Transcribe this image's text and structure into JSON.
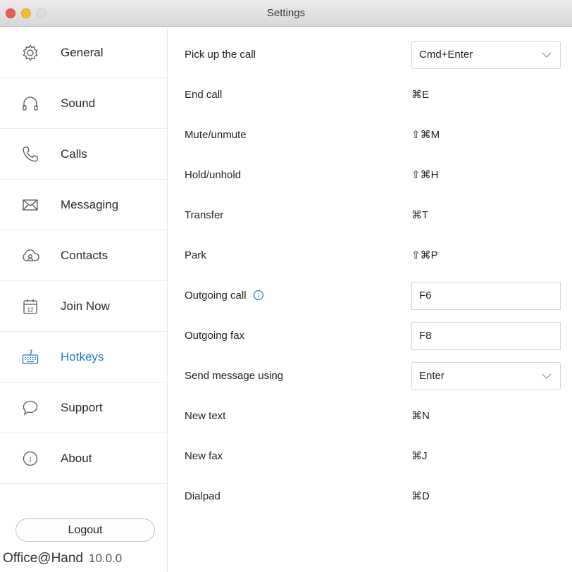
{
  "window": {
    "title": "Settings"
  },
  "sidebar": {
    "items": [
      {
        "label": "General",
        "icon": "gear-icon"
      },
      {
        "label": "Sound",
        "icon": "headphones-icon"
      },
      {
        "label": "Calls",
        "icon": "phone-icon"
      },
      {
        "label": "Messaging",
        "icon": "envelope-icon"
      },
      {
        "label": "Contacts",
        "icon": "cloud-contacts-icon"
      },
      {
        "label": "Join Now",
        "icon": "calendar-icon"
      },
      {
        "label": "Hotkeys",
        "icon": "keyboard-icon",
        "active": true
      },
      {
        "label": "Support",
        "icon": "chat-bubble-icon"
      },
      {
        "label": "About",
        "icon": "info-icon"
      }
    ],
    "logout_label": "Logout"
  },
  "footer": {
    "brand": "Office@Hand",
    "version": "10.0.0"
  },
  "accent_color": "#1f7ac8",
  "hotkeys": [
    {
      "label": "Pick up the call",
      "type": "select",
      "value": "Cmd+Enter"
    },
    {
      "label": "End call",
      "type": "text",
      "value": "⌘E"
    },
    {
      "label": "Mute/unmute",
      "type": "text",
      "value": "⇧⌘M"
    },
    {
      "label": "Hold/unhold",
      "type": "text",
      "value": "⇧⌘H"
    },
    {
      "label": "Transfer",
      "type": "text",
      "value": "⌘T"
    },
    {
      "label": "Park",
      "type": "text",
      "value": "⇧⌘P"
    },
    {
      "label": "Outgoing call",
      "type": "input",
      "value": "F6",
      "info": true
    },
    {
      "label": "Outgoing fax",
      "type": "input",
      "value": "F8"
    },
    {
      "label": "Send message using",
      "type": "select",
      "value": "Enter"
    },
    {
      "label": "New text",
      "type": "text",
      "value": "⌘N"
    },
    {
      "label": "New fax",
      "type": "text",
      "value": "⌘J"
    },
    {
      "label": "Dialpad",
      "type": "text",
      "value": "⌘D"
    }
  ]
}
